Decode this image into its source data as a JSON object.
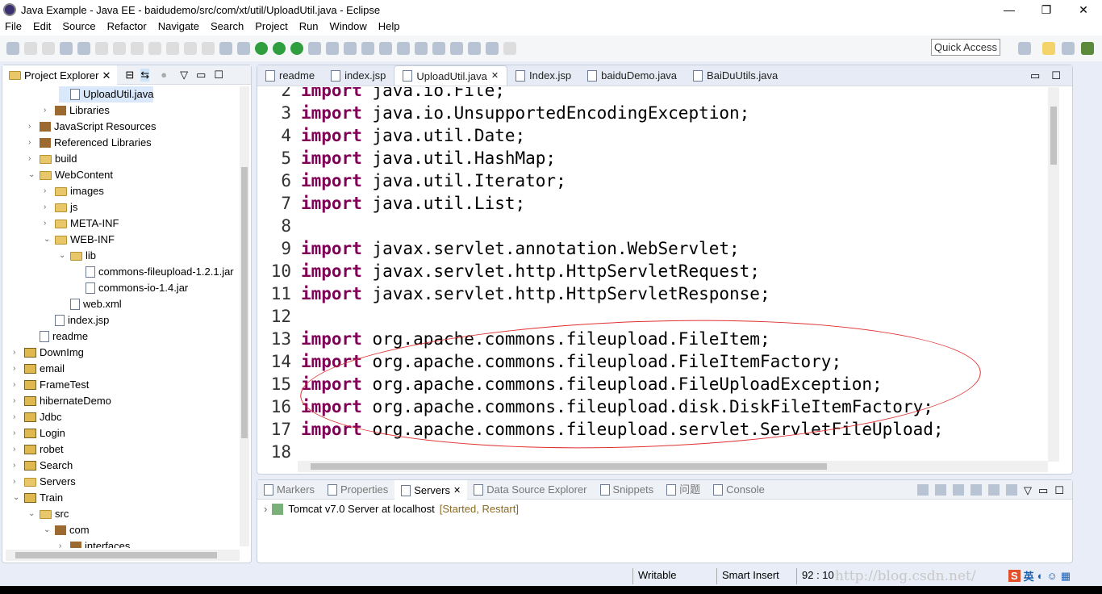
{
  "window": {
    "title": "Java Example - Java EE - baidudemo/src/com/xt/util/UploadUtil.java - Eclipse",
    "controls": [
      "—",
      "❐",
      "✕"
    ]
  },
  "menu": [
    "File",
    "Edit",
    "Source",
    "Refactor",
    "Navigate",
    "Search",
    "Project",
    "Run",
    "Window",
    "Help"
  ],
  "quick_access": "Quick Access",
  "project_explorer": {
    "title": "Project Explorer",
    "items": [
      {
        "label": "UploadUtil.java",
        "depth": 4,
        "icon": "java-file-icon",
        "chev": "",
        "selected": true
      },
      {
        "label": "Libraries",
        "depth": 3,
        "icon": "library-icon",
        "chev": "›"
      },
      {
        "label": "JavaScript Resources",
        "depth": 2,
        "icon": "library-icon",
        "chev": "›"
      },
      {
        "label": "Referenced Libraries",
        "depth": 2,
        "icon": "library-icon",
        "chev": "›"
      },
      {
        "label": "build",
        "depth": 2,
        "icon": "folder-icon",
        "chev": "›"
      },
      {
        "label": "WebContent",
        "depth": 2,
        "icon": "folder-icon",
        "chev": "⌄"
      },
      {
        "label": "images",
        "depth": 3,
        "icon": "folder-icon",
        "chev": "›"
      },
      {
        "label": "js",
        "depth": 3,
        "icon": "folder-icon",
        "chev": "›"
      },
      {
        "label": "META-INF",
        "depth": 3,
        "icon": "folder-icon",
        "chev": "›"
      },
      {
        "label": "WEB-INF",
        "depth": 3,
        "icon": "folder-icon",
        "chev": "⌄"
      },
      {
        "label": "lib",
        "depth": 4,
        "icon": "folder-icon",
        "chev": "⌄"
      },
      {
        "label": "commons-fileupload-1.2.1.jar",
        "depth": 5,
        "icon": "jar-icon",
        "chev": ""
      },
      {
        "label": "commons-io-1.4.jar",
        "depth": 5,
        "icon": "jar-icon",
        "chev": ""
      },
      {
        "label": "web.xml",
        "depth": 4,
        "icon": "xml-file-icon",
        "chev": ""
      },
      {
        "label": "index.jsp",
        "depth": 3,
        "icon": "jsp-file-icon",
        "chev": ""
      },
      {
        "label": "readme",
        "depth": 2,
        "icon": "text-file-icon",
        "chev": ""
      },
      {
        "label": "DownImg",
        "depth": 1,
        "icon": "project-icon",
        "chev": "›"
      },
      {
        "label": "email",
        "depth": 1,
        "icon": "project-icon",
        "chev": "›"
      },
      {
        "label": "FrameTest",
        "depth": 1,
        "icon": "project-icon",
        "chev": "›"
      },
      {
        "label": "hibernateDemo",
        "depth": 1,
        "icon": "project-icon",
        "chev": "›"
      },
      {
        "label": "Jdbc",
        "depth": 1,
        "icon": "project-icon",
        "chev": "›"
      },
      {
        "label": "Login",
        "depth": 1,
        "icon": "project-icon",
        "chev": "›"
      },
      {
        "label": "robet",
        "depth": 1,
        "icon": "project-icon",
        "chev": "›"
      },
      {
        "label": "Search",
        "depth": 1,
        "icon": "project-icon",
        "chev": "›"
      },
      {
        "label": "Servers",
        "depth": 1,
        "icon": "folder-icon",
        "chev": "›"
      },
      {
        "label": "Train",
        "depth": 1,
        "icon": "project-icon",
        "chev": "⌄"
      },
      {
        "label": "src",
        "depth": 2,
        "icon": "source-folder-icon",
        "chev": "⌄"
      },
      {
        "label": "com",
        "depth": 3,
        "icon": "package-icon",
        "chev": "⌄"
      },
      {
        "label": "interfaces",
        "depth": 4,
        "icon": "package-icon",
        "chev": "›"
      }
    ]
  },
  "editor": {
    "tabs": [
      {
        "label": "readme",
        "active": false
      },
      {
        "label": "index.jsp",
        "active": false
      },
      {
        "label": "UploadUtil.java",
        "active": true
      },
      {
        "label": "Index.jsp",
        "active": false
      },
      {
        "label": "baiduDemo.java",
        "active": false
      },
      {
        "label": "BaiDuUtils.java",
        "active": false
      }
    ],
    "lines": [
      {
        "n": "2",
        "kw": "import",
        "rest": " java.io.File;"
      },
      {
        "n": "3",
        "kw": "import",
        "rest": " java.io.UnsupportedEncodingException;"
      },
      {
        "n": "4",
        "kw": "import",
        "rest": " java.util.Date;"
      },
      {
        "n": "5",
        "kw": "import",
        "rest": " java.util.HashMap;"
      },
      {
        "n": "6",
        "kw": "import",
        "rest": " java.util.Iterator;"
      },
      {
        "n": "7",
        "kw": "import",
        "rest": " java.util.List;"
      },
      {
        "n": "8",
        "kw": "",
        "rest": ""
      },
      {
        "n": "9",
        "kw": "import",
        "rest": " javax.servlet.annotation.WebServlet;"
      },
      {
        "n": "10",
        "kw": "import",
        "rest": " javax.servlet.http.HttpServletRequest;"
      },
      {
        "n": "11",
        "kw": "import",
        "rest": " javax.servlet.http.HttpServletResponse;"
      },
      {
        "n": "12",
        "kw": "",
        "rest": ""
      },
      {
        "n": "13",
        "kw": "import",
        "rest": " org.apache.commons.fileupload.FileItem;"
      },
      {
        "n": "14",
        "kw": "import",
        "rest": " org.apache.commons.fileupload.FileItemFactory;"
      },
      {
        "n": "15",
        "kw": "import",
        "rest": " org.apache.commons.fileupload.FileUploadException;"
      },
      {
        "n": "16",
        "kw": "import",
        "rest": " org.apache.commons.fileupload.disk.DiskFileItemFactory;"
      },
      {
        "n": "17",
        "kw": "import",
        "rest": " org.apache.commons.fileupload.servlet.ServletFileUpload;"
      },
      {
        "n": "18",
        "kw": "",
        "rest": ""
      }
    ]
  },
  "bottom_panel": {
    "tabs": [
      "Markers",
      "Properties",
      "Servers",
      "Data Source Explorer",
      "Snippets",
      "问题",
      "Console"
    ],
    "active": "Servers",
    "server": {
      "name": "Tomcat v7.0 Server at localhost",
      "state": "[Started, Restart]"
    }
  },
  "status": {
    "writable": "Writable",
    "insert_mode": "Smart Insert",
    "position": "92 : 10"
  },
  "watermark": "http://blog.csdn.net/",
  "ime": {
    "lang": "英"
  },
  "colors": {
    "keyword": "#7f0055",
    "annotation_ellipse": "#e03030",
    "server_state": "#8a6a20"
  }
}
